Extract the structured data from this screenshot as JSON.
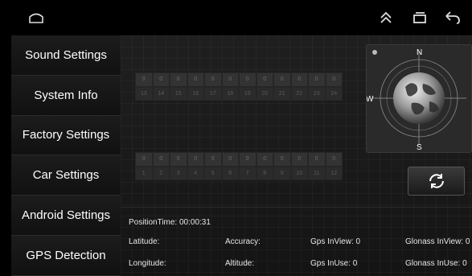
{
  "nav": {
    "home_icon": "home-icon",
    "up_icon": "chevron-up-double-icon",
    "recent_icon": "recent-apps-icon",
    "back_icon": "back-icon"
  },
  "sidebar": {
    "items": [
      {
        "label": "Sound Settings"
      },
      {
        "label": "System Info"
      },
      {
        "label": "Factory Settings"
      },
      {
        "label": "Car Settings"
      },
      {
        "label": "Android Settings"
      },
      {
        "label": "GPS Detection"
      }
    ]
  },
  "satellites": {
    "top": {
      "signals": [
        "0",
        "0",
        "0",
        "0",
        "0",
        "0",
        "0",
        "0",
        "0",
        "0",
        "0",
        "0"
      ],
      "ids": [
        "13",
        "14",
        "15",
        "16",
        "17",
        "18",
        "19",
        "20",
        "21",
        "22",
        "23",
        "24"
      ]
    },
    "bottom": {
      "signals": [
        "0",
        "0",
        "0",
        "0",
        "0",
        "0",
        "0",
        "0",
        "0",
        "0",
        "0",
        "0"
      ],
      "ids": [
        "1",
        "2",
        "3",
        "4",
        "5",
        "6",
        "7",
        "8",
        "9",
        "10",
        "11",
        "12"
      ]
    }
  },
  "compass": {
    "north": "N",
    "south": "S",
    "west": "W"
  },
  "refresh_icon": "refresh-icon",
  "info": {
    "position_time": "PositionTime: 00:00:31",
    "latitude": "Latitude:",
    "accuracy": "Accuracy:",
    "gps_inview": "Gps InView: 0",
    "glonass_inview": "Glonass InView: 0",
    "longitude": "Longitude:",
    "altitude": "Altitude:",
    "gps_inuse": "Gps InUse: 0",
    "glonass_inuse": "Glonass InUse: 0"
  }
}
